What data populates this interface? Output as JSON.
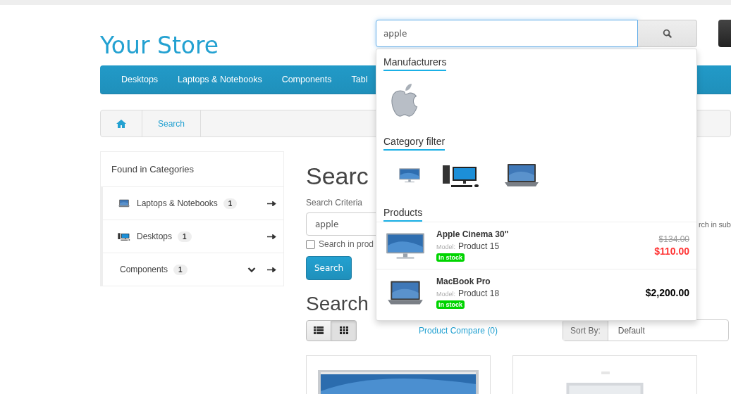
{
  "header": {
    "logo": "Your Store",
    "search": {
      "value": "apple"
    }
  },
  "nav": {
    "items": [
      "Desktops",
      "Laptops & Notebooks",
      "Components",
      "Tabl"
    ]
  },
  "breadcrumb": [
    "Search"
  ],
  "categories": {
    "title": "Found in Categories",
    "items": [
      {
        "label": "Laptops & Notebooks",
        "count": "1",
        "kind": "laptop"
      },
      {
        "label": "Desktops",
        "count": "1",
        "kind": "desktop"
      },
      {
        "label": "Components",
        "count": "1",
        "kind": "expandable"
      }
    ]
  },
  "search_form": {
    "heading": "Searc",
    "criteria_label": "Search Criteria",
    "value": "apple",
    "checkbox_label": "Search in prod",
    "checked": false,
    "subcategory_label": "rch in sub",
    "button": "Search"
  },
  "results": {
    "heading": "Search",
    "views": [
      {
        "kind": "list",
        "selected": false
      },
      {
        "kind": "grid",
        "selected": true
      }
    ],
    "compare_link": "Product Compare (0)",
    "sort_label": "Sort By:",
    "sort_value": "Default"
  },
  "dropdown": {
    "manufacturers_title": "Manufacturers",
    "manufacturers": [
      {
        "kind": "apple"
      }
    ],
    "category_title": "Category filter",
    "categories": [
      {
        "kind": "imac"
      },
      {
        "kind": "desktop"
      },
      {
        "kind": "laptop"
      }
    ],
    "products_title": "Products",
    "products": [
      {
        "kind": "monitor",
        "name": "Apple Cinema 30\"",
        "model_label": "Model:",
        "model": "Product 15",
        "stock": "In stock",
        "old_price": "$134.00",
        "price": "$110.00"
      },
      {
        "kind": "laptops",
        "name": "MacBook Pro",
        "model_label": "Model:",
        "model": "Product 18",
        "stock": "In stock",
        "price": "$2,200.00"
      }
    ]
  }
}
